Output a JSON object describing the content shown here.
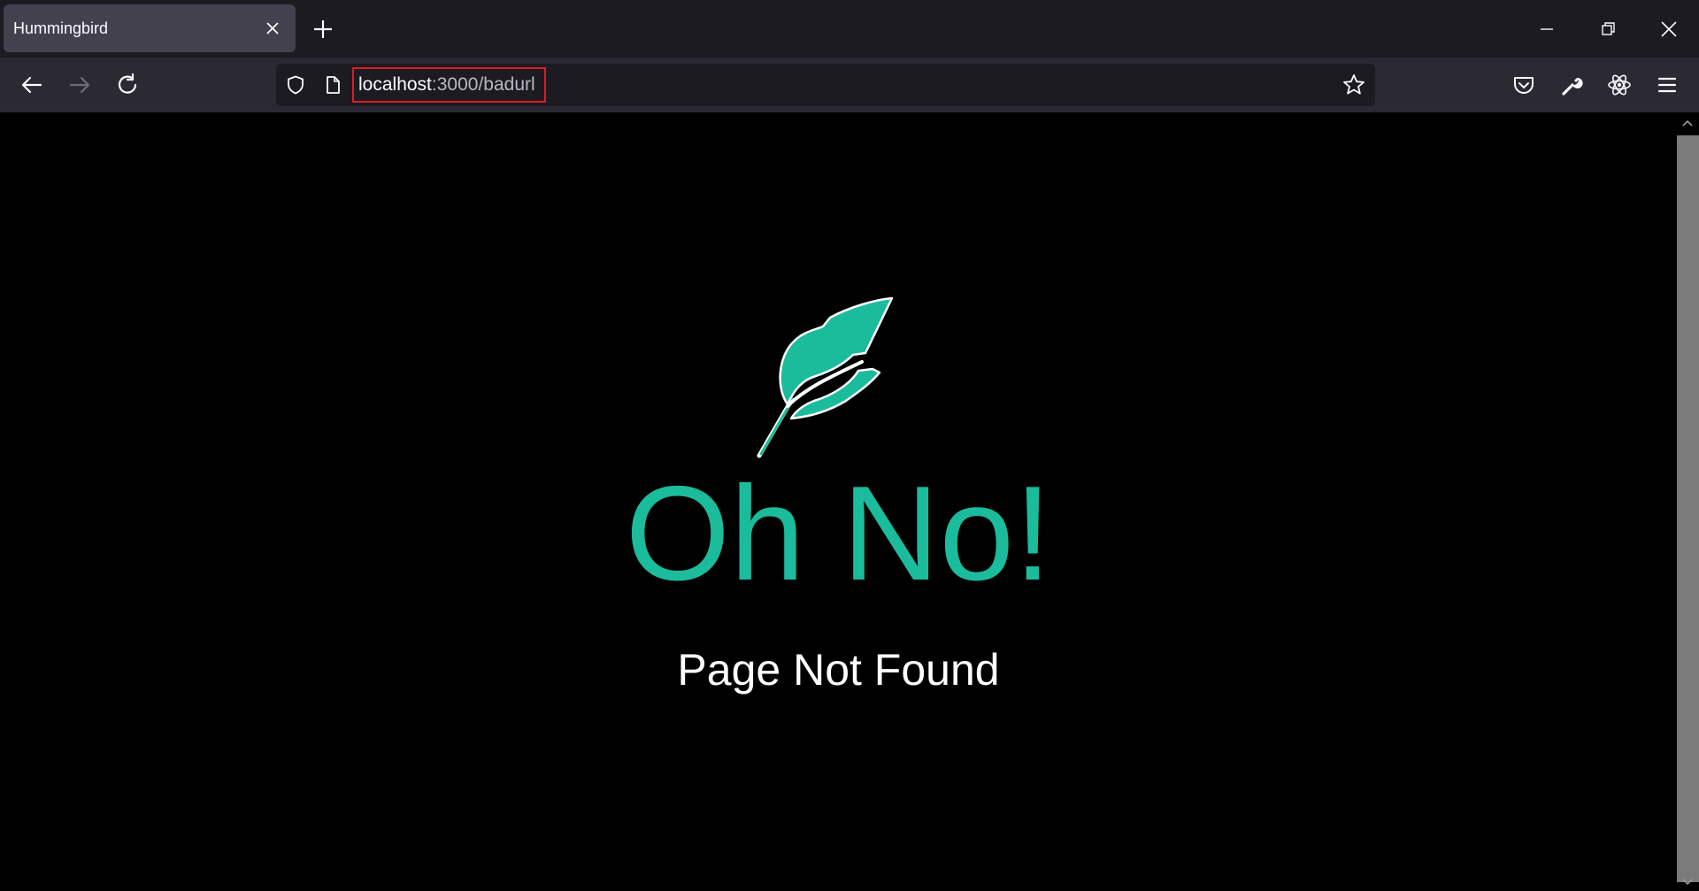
{
  "tab": {
    "title": "Hummingbird"
  },
  "address_bar": {
    "url_host": "localhost",
    "url_rest": ":3000/badurl"
  },
  "page": {
    "headline": "Oh No!",
    "subheadline": "Page Not Found"
  },
  "icons": {
    "tab_close": "close-icon",
    "new_tab": "plus-icon",
    "minimize": "minimize-icon",
    "restore": "restore-icon",
    "close_window": "close-icon",
    "back": "back-arrow-icon",
    "forward": "forward-arrow-icon",
    "reload": "reload-icon",
    "tracking_protection": "shield-icon",
    "page_info": "page-icon",
    "bookmark": "star-icon",
    "pocket": "pocket-icon",
    "devtools": "wrench-icon",
    "react_devtools": "react-icon",
    "menu": "hamburger-menu-icon",
    "logo": "feather-icon"
  },
  "colors": {
    "accent": "#1abc9c",
    "page_background": "#000000",
    "text": "#ffffff",
    "url_highlight": "#e01b24"
  }
}
